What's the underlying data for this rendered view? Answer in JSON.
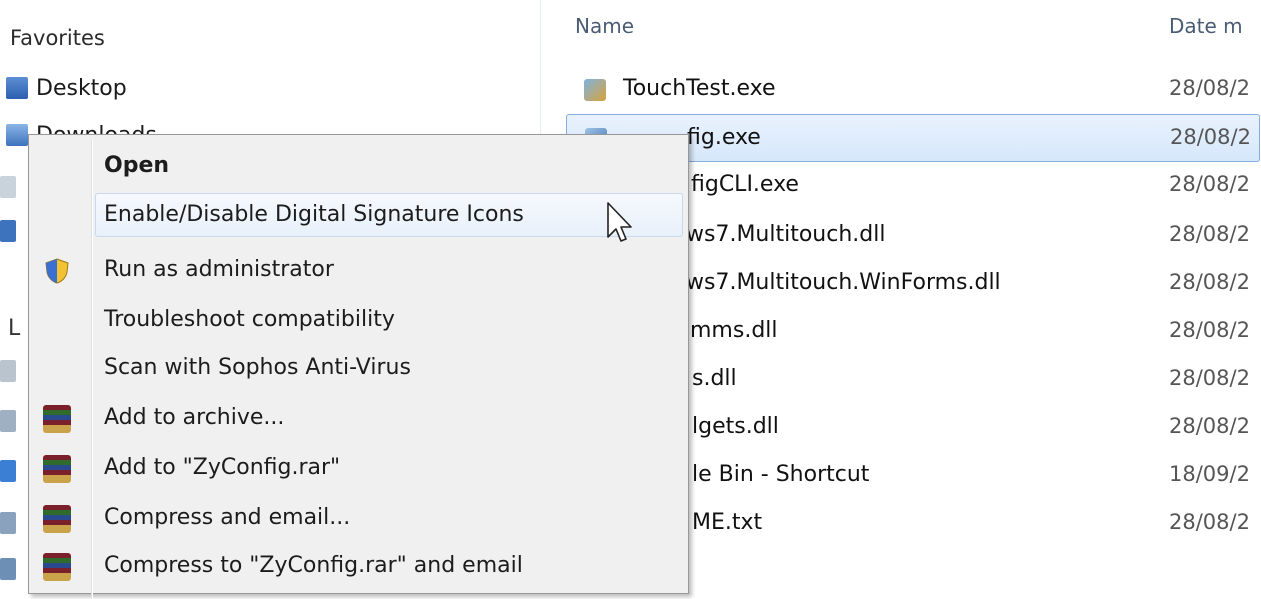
{
  "nav": {
    "favorites_header": "Favorites",
    "items": [
      {
        "label": "Desktop",
        "icon": "desktop-icon"
      },
      {
        "label": "Downloads",
        "icon": "downloads-icon"
      }
    ],
    "section_stub": "L"
  },
  "columns": {
    "name": "Name",
    "date": "Date m"
  },
  "files": [
    {
      "name": "TouchTest.exe",
      "date": "28/08/2",
      "icon": "exe-icon"
    },
    {
      "name": "ZyConfig.exe",
      "visible_name": "fig.exe",
      "date": "28/08/2",
      "selected": true
    },
    {
      "name": "figCLI.exe",
      "date": "28/08/2"
    },
    {
      "name": "ws7.Multitouch.dll",
      "date": "28/08/2"
    },
    {
      "name": "ws7.Multitouch.WinForms.dll",
      "date": "28/08/2"
    },
    {
      "name": "mms.dll",
      "date": "28/08/2"
    },
    {
      "name": "s.dll",
      "date": "28/08/2"
    },
    {
      "name": "lgets.dll",
      "date": "28/08/2"
    },
    {
      "name": "le Bin - Shortcut",
      "date": "18/09/2"
    },
    {
      "name": "ME.txt",
      "date": "28/08/2"
    }
  ],
  "context_menu": {
    "items": [
      {
        "label": "Open",
        "bold": true,
        "icon": ""
      },
      {
        "label": "Enable/Disable Digital Signature Icons",
        "highlighted": true,
        "icon": ""
      },
      {
        "label": "Run as administrator",
        "icon": "uac-shield-icon"
      },
      {
        "label": "Troubleshoot compatibility",
        "icon": ""
      },
      {
        "label": "Scan with Sophos Anti-Virus",
        "icon": ""
      },
      {
        "label": "Add to archive...",
        "icon": "winrar-icon"
      },
      {
        "label": "Add to \"ZyConfig.rar\"",
        "icon": "winrar-icon"
      },
      {
        "label": "Compress and email...",
        "icon": "winrar-icon"
      },
      {
        "label": "Compress to \"ZyConfig.rar\" and email",
        "icon": "winrar-icon"
      }
    ]
  },
  "colors": {
    "selection": "#d6e7fb",
    "selection_border": "#84acdd",
    "menu_bg": "#f0f0f0",
    "header_text": "#4a5d75"
  }
}
